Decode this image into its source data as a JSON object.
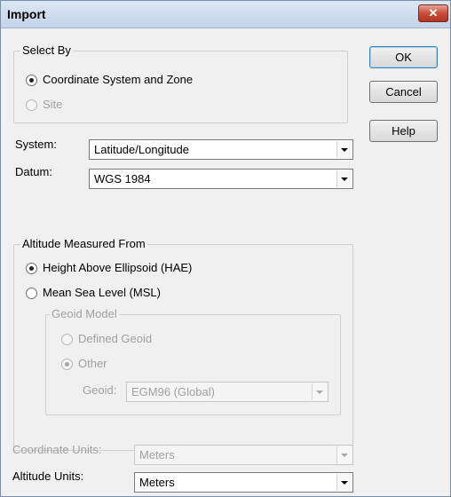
{
  "window": {
    "title": "Import",
    "close_icon": "close-icon"
  },
  "buttons": {
    "ok": "OK",
    "cancel": "Cancel",
    "help": "Help"
  },
  "select_by": {
    "label": "Select By",
    "options": [
      {
        "label": "Coordinate System and Zone",
        "selected": true,
        "enabled": true
      },
      {
        "label": "Site",
        "selected": false,
        "enabled": false
      }
    ]
  },
  "system": {
    "label": "System:",
    "value": "Latitude/Longitude"
  },
  "datum": {
    "label": "Datum:",
    "value": "WGS 1984"
  },
  "altitude": {
    "label": "Altitude Measured From",
    "options": [
      {
        "label": "Height Above Ellipsoid (HAE)",
        "selected": true,
        "enabled": true
      },
      {
        "label": "Mean Sea Level (MSL)",
        "selected": false,
        "enabled": true
      }
    ],
    "geoid_model": {
      "label": "Geoid Model",
      "options": [
        {
          "label": "Defined Geoid",
          "selected": false,
          "enabled": false
        },
        {
          "label": "Other",
          "selected": true,
          "enabled": false
        }
      ],
      "geoid_label": "Geoid:",
      "geoid_value": "EGM96 (Global)"
    }
  },
  "coordinate_units": {
    "label": "Coordinate Units:",
    "value": "Meters"
  },
  "altitude_units": {
    "label": "Altitude Units:",
    "value": "Meters"
  }
}
